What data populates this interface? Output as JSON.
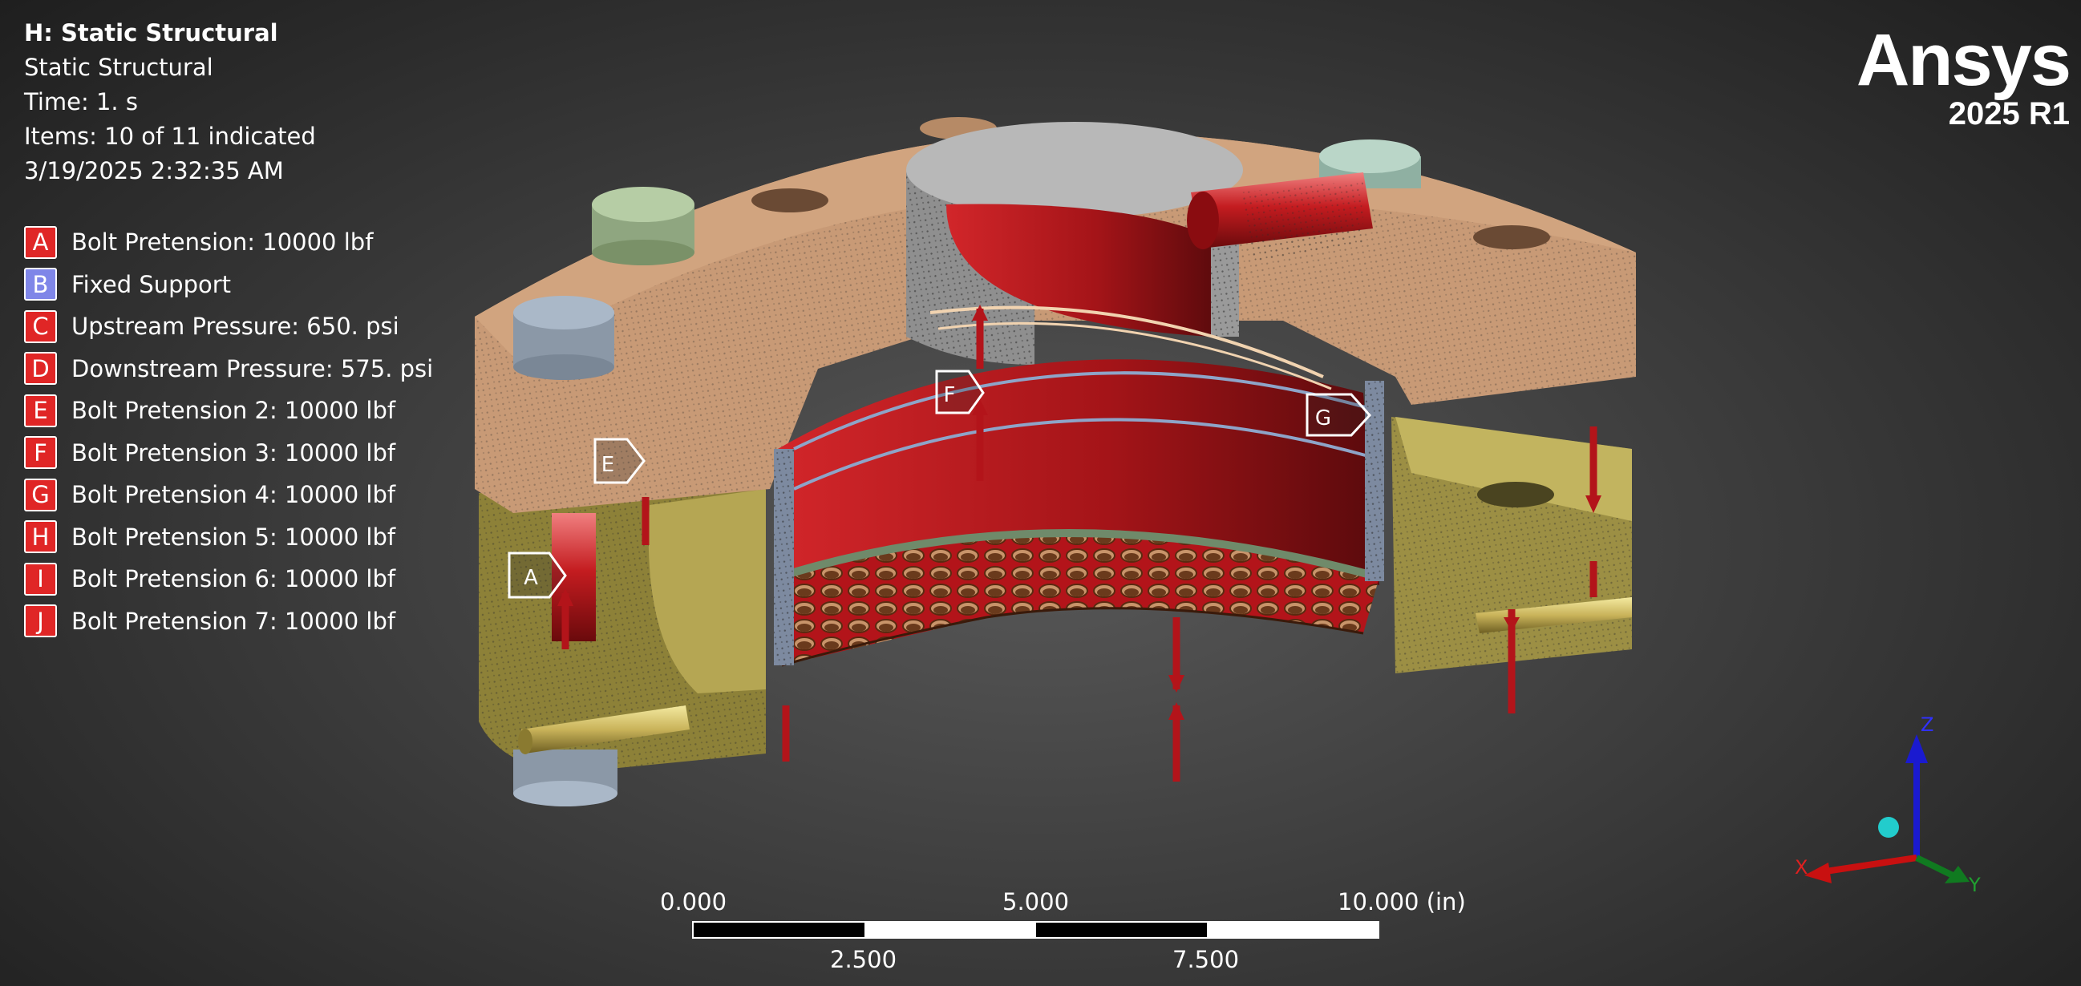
{
  "header": {
    "title": "H: Static Structural",
    "analysis": "Static Structural",
    "time": "Time: 1. s",
    "items": "Items: 10 of 11 indicated",
    "date": "3/19/2025 2:32:35 AM"
  },
  "legend": [
    {
      "letter": "A",
      "label": "Bolt Pretension: 10000 lbf",
      "color": "#e02626"
    },
    {
      "letter": "B",
      "label": "Fixed Support",
      "color": "#7f86e8"
    },
    {
      "letter": "C",
      "label": "Upstream Pressure: 650. psi",
      "color": "#e02626"
    },
    {
      "letter": "D",
      "label": "Downstream Pressure: 575. psi",
      "color": "#e02626"
    },
    {
      "letter": "E",
      "label": "Bolt Pretension 2: 10000 lbf",
      "color": "#e02626"
    },
    {
      "letter": "F",
      "label": "Bolt Pretension 3: 10000 lbf",
      "color": "#e02626"
    },
    {
      "letter": "G",
      "label": "Bolt Pretension 4: 10000 lbf",
      "color": "#e02626"
    },
    {
      "letter": "H",
      "label": "Bolt Pretension 5: 10000 lbf",
      "color": "#e02626"
    },
    {
      "letter": "I",
      "label": "Bolt Pretension 6: 10000 lbf",
      "color": "#e02626"
    },
    {
      "letter": "J",
      "label": "Bolt Pretension 7: 10000 lbf",
      "color": "#e02626"
    }
  ],
  "logo": {
    "brand": "Ansys",
    "version": "2025 R1"
  },
  "model_tags": {
    "a": "A",
    "e": "E",
    "f": "F",
    "g": "G"
  },
  "scale": {
    "l0": "0.000",
    "l5": "5.000",
    "l10": "10.000 (in)",
    "l25": "2.500",
    "l75": "7.500"
  },
  "triad": {
    "x": "X",
    "y": "Y",
    "z": "Z"
  },
  "colors": {
    "upper_flange": "#c89a76",
    "lower_flange": "#9c8f44",
    "pressure_red": "#b3141a",
    "bolt_gray": "#9aa7b6",
    "bolt_green": "#9fb890",
    "background": "#3e3e3e"
  }
}
